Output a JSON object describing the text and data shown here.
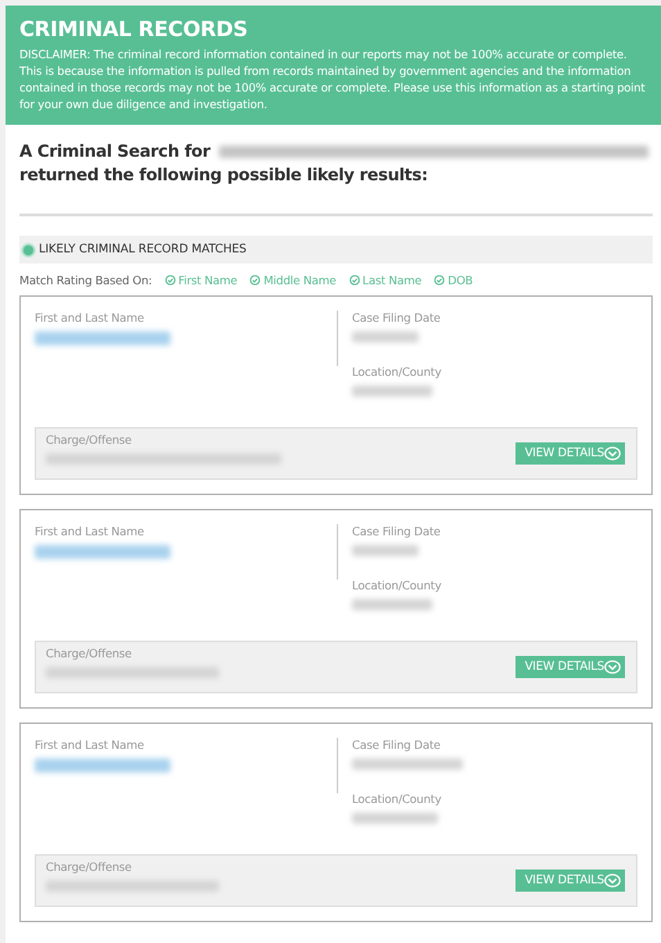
{
  "header": {
    "title": "CRIMINAL RECORDS",
    "disclaimer": "DISCLAIMER: The criminal record information contained in our reports may not be 100% accurate or complete. This is because the information is pulled from records maintained by government agencies and the information contained in those records may not be 100% accurate or complete. Please use this information as a starting point for your own due diligence and investigation."
  },
  "search": {
    "prefix": "A Criminal Search for",
    "suffix": "returned the following possible likely results:"
  },
  "section": {
    "title": "LIKELY CRIMINAL RECORD MATCHES",
    "selected": true
  },
  "match_rating": {
    "label": "Match Rating Based On:",
    "criteria": [
      "First Name",
      "Middle Name",
      "Last Name",
      "DOB"
    ]
  },
  "records": [
    {
      "name_label": "First and Last Name",
      "date_label": "Case Filing Date",
      "location_label": "Location/County",
      "charge_label": "Charge/Offense",
      "button": "VIEW DETAILS"
    },
    {
      "name_label": "First and Last Name",
      "date_label": "Case Filing Date",
      "location_label": "Location/County",
      "charge_label": "Charge/Offense",
      "button": "VIEW DETAILS"
    },
    {
      "name_label": "First and Last Name",
      "date_label": "Case Filing Date",
      "location_label": "Location/County",
      "charge_label": "Charge/Offense",
      "button": "VIEW DETAILS"
    }
  ]
}
